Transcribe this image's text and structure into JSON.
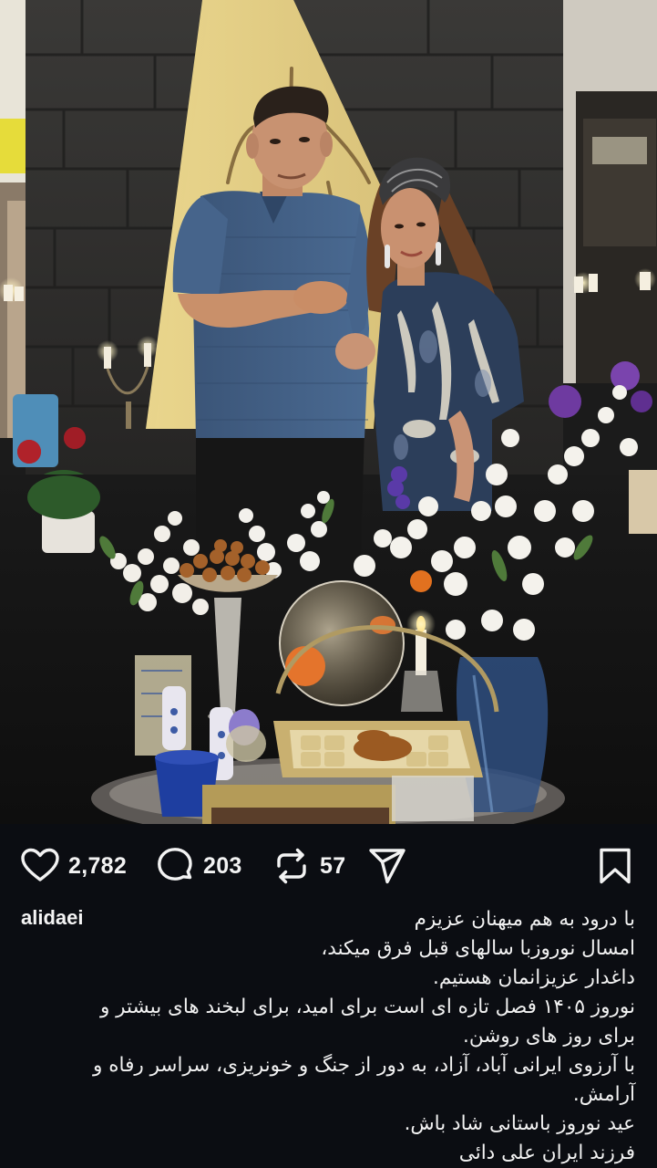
{
  "post": {
    "username": "alidaei",
    "photo_label": "",
    "stats": {
      "likes": "2,782",
      "comments": "203",
      "reposts": "57"
    },
    "icons": {
      "like": "heart-icon",
      "comment": "comment-bubble-icon",
      "repost": "repost-icon",
      "share": "paper-plane-icon",
      "save": "bookmark-icon"
    },
    "caption_lines": [
      "با درود به هم میهنان عزیزم",
      "امسال نوروزبا سالهای قبل فرق میکند،",
      "داغدار عزیزانمان هستیم.",
      "نوروز ۱۴۰۵ فصل تازه ای است برای امید، برای لبخند های بیشتر و",
      "برای روز های روشن.",
      "با آرزوی ایرانی آباد، آزاد، به دور از جنگ و خونریزی، سراسر رفاه و",
      "آرامش.",
      "عید نوروز باستانی شاد باش.",
      "فرزند ایران علی دائی"
    ]
  },
  "colors": {
    "background": "#0b0d12",
    "text": "#f2f2f2"
  }
}
